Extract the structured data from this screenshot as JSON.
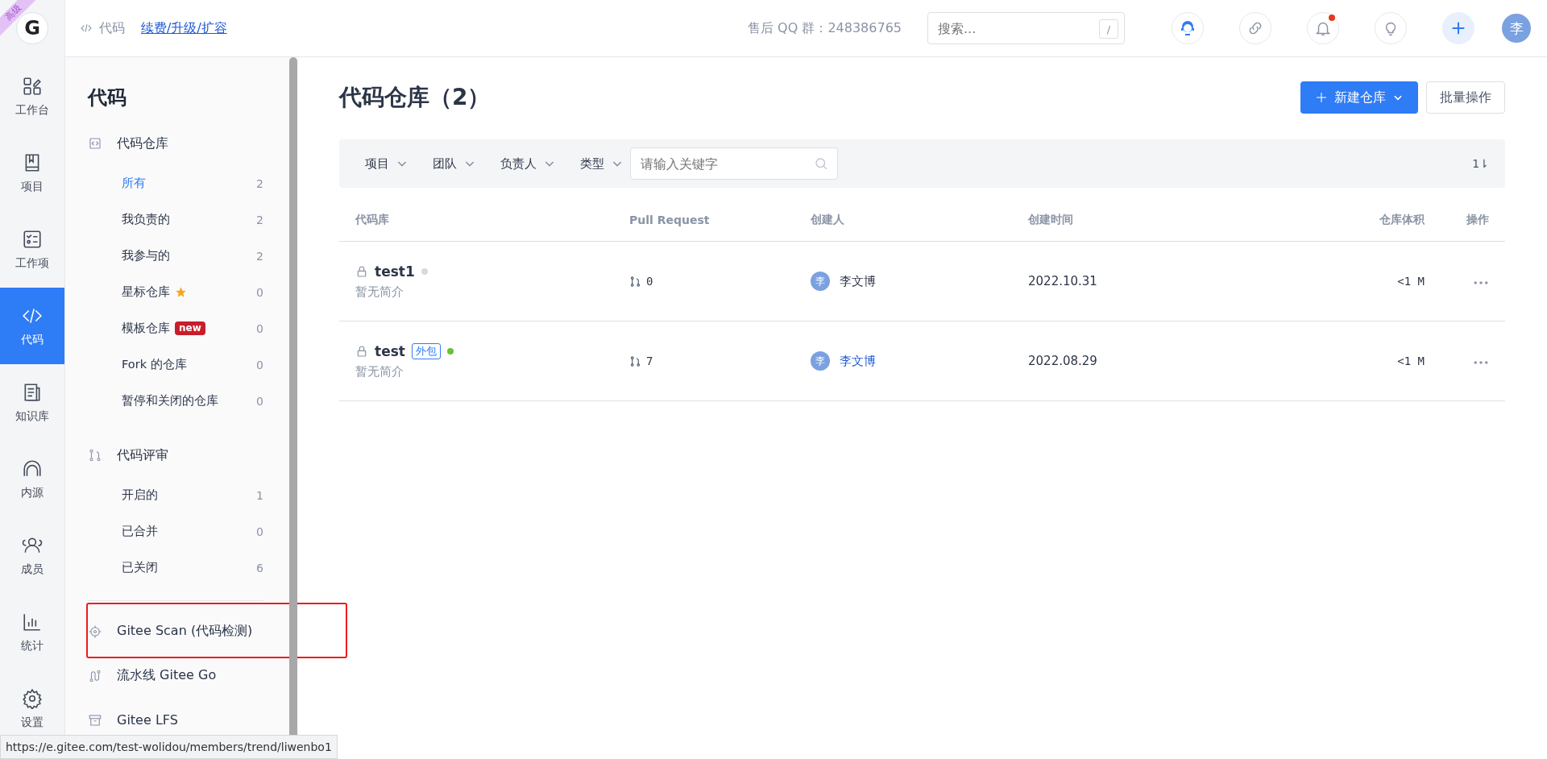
{
  "rail": {
    "logo": "G",
    "ribbon": "高级",
    "items": [
      {
        "label": "工作台",
        "selected": false
      },
      {
        "label": "项目",
        "selected": false
      },
      {
        "label": "工作项",
        "selected": false
      },
      {
        "label": "代码",
        "selected": true
      },
      {
        "label": "知识库",
        "selected": false
      },
      {
        "label": "内源",
        "selected": false
      },
      {
        "label": "成员",
        "selected": false
      },
      {
        "label": "统计",
        "selected": false
      },
      {
        "label": "设置",
        "selected": false
      }
    ]
  },
  "topbar": {
    "breadcrumb": "代码",
    "link": "续费/升级/扩容",
    "support": "售后 QQ 群：248386765",
    "search": {
      "placeholder": "搜索...",
      "shortcut": "/"
    },
    "notification_dot": true,
    "avatar": "李"
  },
  "sidebar": {
    "title": "代码",
    "groups": [
      {
        "label": "代码仓库",
        "items": [
          {
            "label": "所有",
            "count": "2",
            "selected": true
          },
          {
            "label": "我负责的",
            "count": "2",
            "selected": false
          },
          {
            "label": "我参与的",
            "count": "2",
            "selected": false
          },
          {
            "label": "星标仓库",
            "count": "0",
            "selected": false,
            "kind": "starred"
          },
          {
            "label": "模板仓库",
            "count": "0",
            "selected": false,
            "kind": "badged",
            "badge": "new"
          },
          {
            "label": "Fork 的仓库",
            "count": "0",
            "selected": false
          },
          {
            "label": "暂停和关闭的仓库",
            "count": "0",
            "selected": false
          }
        ]
      },
      {
        "label": "代码评审",
        "items": [
          {
            "label": "开启的",
            "count": "1",
            "selected": false
          },
          {
            "label": "已合并",
            "count": "0",
            "selected": false
          },
          {
            "label": "已关闭",
            "count": "6",
            "selected": false
          }
        ]
      }
    ],
    "links": [
      {
        "label": "Gitee Scan (代码检测)",
        "highlighted": true
      },
      {
        "label": "流水线 Gitee Go",
        "highlighted": false
      },
      {
        "label": "Gitee LFS",
        "highlighted": false
      }
    ]
  },
  "main": {
    "title": "代码仓库（2）",
    "new_button": "新建仓库",
    "batch_button": "批量操作",
    "filters": [
      "项目",
      "团队",
      "负责人",
      "类型"
    ],
    "keyword": {
      "placeholder": "请输入关键字"
    },
    "sort": "1⇂",
    "table": {
      "columns": [
        "代码库",
        "Pull Request",
        "创建人",
        "创建时间",
        "仓库体积",
        "操作"
      ],
      "rows": [
        {
          "name": "test1",
          "color": "#d9d9d9",
          "description": "暂无简介",
          "pull_requests": "0",
          "creator_avatar": "李",
          "creator": "李文博",
          "creator_hovered": false,
          "created": "2022.10.31",
          "size": "<1 M"
        },
        {
          "name": "test",
          "tag": "外包",
          "color": "#67c23a",
          "description": "暂无简介",
          "pull_requests": "7",
          "creator_avatar": "李",
          "creator": "李文博",
          "creator_hovered": true,
          "created": "2022.08.29",
          "size": "<1 M"
        }
      ]
    }
  },
  "status_url": "https://e.gitee.com/test-wolidou/members/trend/liwenbo1"
}
